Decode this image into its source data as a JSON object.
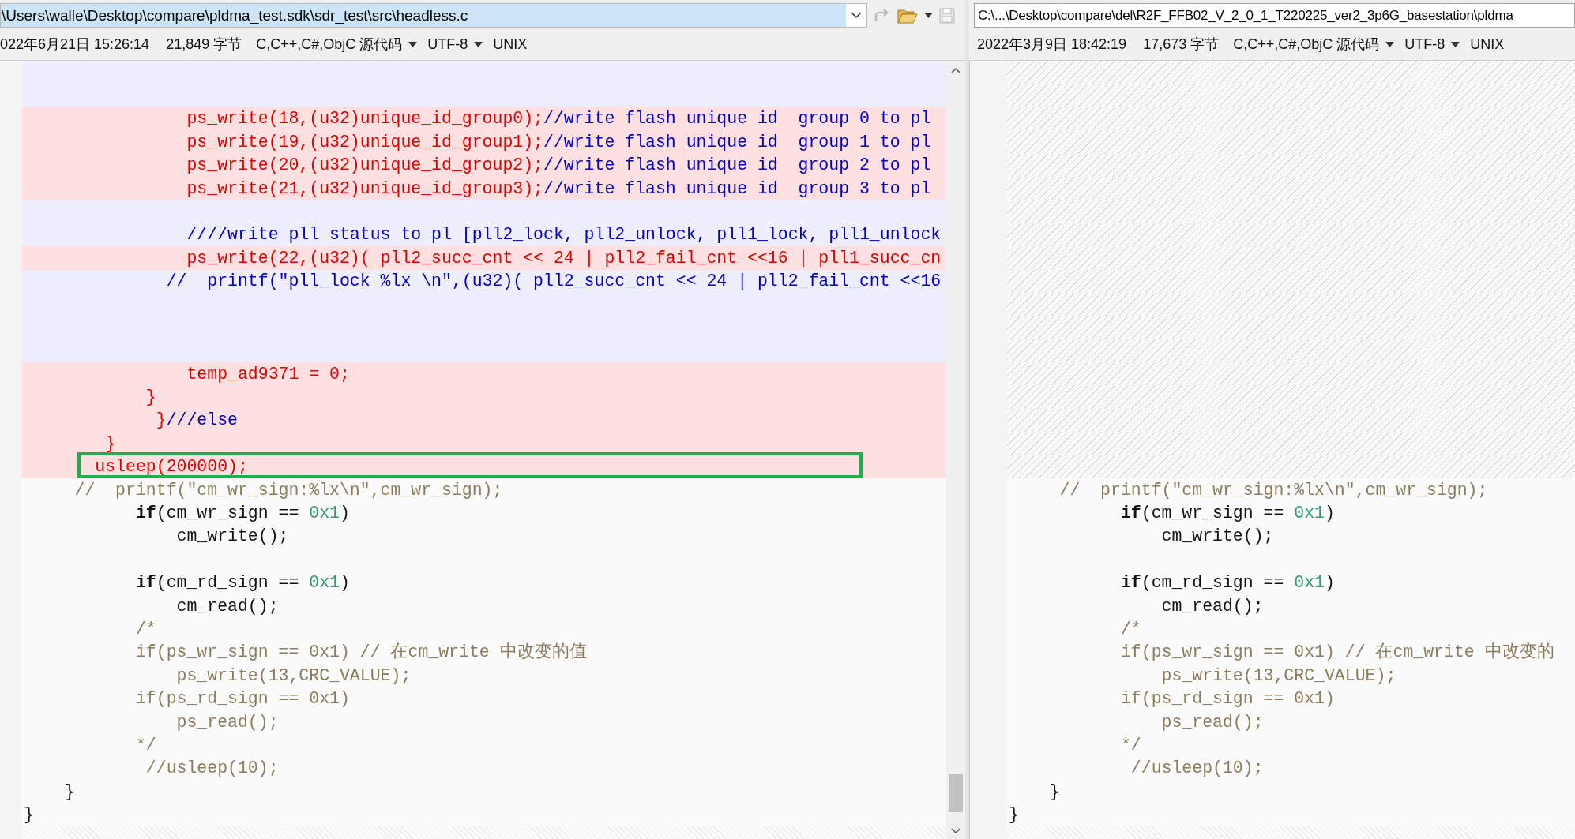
{
  "panes": [
    {
      "path": "\\Users\\walle\\Desktop\\compare\\pldma_test.sdk\\sdr_test\\src\\headless.c",
      "path_selected": true,
      "toolbar": true,
      "modified": "022年6月21日 15:26:14",
      "size": "21,849 字节",
      "format": "C,C++,C#,ObjC 源代码",
      "encoding": "UTF-8",
      "line_ending": "UNIX",
      "scrollbar": true,
      "lines": [
        {
          "kind": "changed"
        },
        {
          "kind": "changed"
        },
        {
          "kind": "removed",
          "segments": [
            {
              "text": "                ps_write(18,(u32)unique_id_group0);",
              "kind": "deleted"
            },
            {
              "text": "//write flash unique id  group 0 to pl",
              "kind": "deleted-comment"
            }
          ]
        },
        {
          "kind": "removed",
          "segments": [
            {
              "text": "                ps_write(19,(u32)unique_id_group1);",
              "kind": "deleted"
            },
            {
              "text": "//write flash unique id  group 1 to pl",
              "kind": "deleted-comment"
            }
          ]
        },
        {
          "kind": "removed",
          "segments": [
            {
              "text": "                ps_write(20,(u32)unique_id_group2);",
              "kind": "deleted"
            },
            {
              "text": "//write flash unique id  group 2 to pl",
              "kind": "deleted-comment"
            }
          ]
        },
        {
          "kind": "removed",
          "segments": [
            {
              "text": "                ps_write(21,(u32)unique_id_group3);",
              "kind": "deleted"
            },
            {
              "text": "//write flash unique id  group 3 to pl",
              "kind": "deleted-comment"
            }
          ]
        },
        {
          "kind": "changed"
        },
        {
          "kind": "changed",
          "segments": [
            {
              "text": "                ////write pll status to pl [pll2_lock, pll2_unlock, pll1_lock, pll1_unlock",
              "kind": "deleted-comment"
            }
          ]
        },
        {
          "kind": "removed",
          "segments": [
            {
              "text": "                ps_write(22,(u32)( pll2_succ_cnt << 24 | pll2_fail_cnt <<16 | pll1_succ_cn",
              "kind": "deleted"
            }
          ]
        },
        {
          "kind": "changed",
          "segments": [
            {
              "text": "              //  printf(\"pll_lock %lx \\n\",(u32)( pll2_succ_cnt << 24 | pll2_fail_cnt <<16",
              "kind": "deleted-comment"
            }
          ]
        },
        {
          "kind": "changed"
        },
        {
          "kind": "changed"
        },
        {
          "kind": "changed"
        },
        {
          "kind": "removed",
          "segments": [
            {
              "text": "                temp_ad9371 = 0;",
              "kind": "deleted"
            }
          ]
        },
        {
          "kind": "removed",
          "segments": [
            {
              "text": "            }",
              "kind": "deleted"
            }
          ]
        },
        {
          "kind": "removed",
          "segments": [
            {
              "text": "             }",
              "kind": "deleted"
            },
            {
              "text": "///else",
              "kind": "deleted-comment"
            }
          ]
        },
        {
          "kind": "removed",
          "segments": [
            {
              "text": "        }",
              "kind": "deleted"
            }
          ]
        },
        {
          "kind": "removed",
          "highlighted": true,
          "segments": [
            {
              "text": "       usleep(200000);",
              "kind": "deleted"
            }
          ]
        },
        {
          "kind": "same",
          "segments": [
            {
              "text": "     //  printf(\"cm_wr_sign:%lx\\n\",cm_wr_sign);",
              "kind": "comment"
            }
          ]
        },
        {
          "kind": "same",
          "segments": [
            {
              "text": "           if",
              "kind": "keyword"
            },
            {
              "text": "(cm_wr_sign == ",
              "kind": "plain"
            },
            {
              "text": "0x1",
              "kind": "number"
            },
            {
              "text": ")",
              "kind": "plain"
            }
          ]
        },
        {
          "kind": "same",
          "segments": [
            {
              "text": "               cm_write();",
              "kind": "plain"
            }
          ]
        },
        {
          "kind": "same"
        },
        {
          "kind": "same",
          "segments": [
            {
              "text": "           if",
              "kind": "keyword"
            },
            {
              "text": "(cm_rd_sign == ",
              "kind": "plain"
            },
            {
              "text": "0x1",
              "kind": "number"
            },
            {
              "text": ")",
              "kind": "plain"
            }
          ]
        },
        {
          "kind": "same",
          "segments": [
            {
              "text": "               cm_read();",
              "kind": "plain"
            }
          ]
        },
        {
          "kind": "same",
          "segments": [
            {
              "text": "           /*",
              "kind": "comment"
            }
          ]
        },
        {
          "kind": "same",
          "segments": [
            {
              "text": "           if(ps_wr_sign == 0x1) // 在cm_write 中改变的值",
              "kind": "comment"
            }
          ]
        },
        {
          "kind": "same",
          "segments": [
            {
              "text": "               ps_write(13,CRC_VALUE);",
              "kind": "comment"
            }
          ]
        },
        {
          "kind": "same",
          "segments": [
            {
              "text": "           if(ps_rd_sign == 0x1)",
              "kind": "comment"
            }
          ]
        },
        {
          "kind": "same",
          "segments": [
            {
              "text": "               ps_read();",
              "kind": "comment"
            }
          ]
        },
        {
          "kind": "same",
          "segments": [
            {
              "text": "           */",
              "kind": "comment"
            }
          ]
        },
        {
          "kind": "same",
          "segments": [
            {
              "text": "            //usleep(10);",
              "kind": "comment"
            }
          ]
        },
        {
          "kind": "same",
          "segments": [
            {
              "text": "    }",
              "kind": "plain"
            }
          ]
        },
        {
          "kind": "same",
          "segments": [
            {
              "text": "}",
              "kind": "plain"
            }
          ]
        }
      ]
    },
    {
      "path": "C:\\...\\Desktop\\compare\\del\\R2F_FFB02_V_2_0_1_T220225_ver2_3p6G_basestation\\pldma",
      "path_selected": false,
      "toolbar": false,
      "modified": "2022年3月9日 18:42:19",
      "size": "17,673 字节",
      "format": "C,C++,C#,ObjC 源代码",
      "encoding": "UTF-8",
      "line_ending": "UNIX",
      "scrollbar": false,
      "lines": [
        {
          "kind": "missing"
        },
        {
          "kind": "missing"
        },
        {
          "kind": "missing"
        },
        {
          "kind": "missing"
        },
        {
          "kind": "missing"
        },
        {
          "kind": "missing"
        },
        {
          "kind": "missing"
        },
        {
          "kind": "missing"
        },
        {
          "kind": "missing"
        },
        {
          "kind": "missing"
        },
        {
          "kind": "missing"
        },
        {
          "kind": "missing"
        },
        {
          "kind": "missing"
        },
        {
          "kind": "missing"
        },
        {
          "kind": "missing"
        },
        {
          "kind": "missing"
        },
        {
          "kind": "missing"
        },
        {
          "kind": "missing"
        },
        {
          "kind": "same",
          "segments": [
            {
              "text": "     //  printf(\"cm_wr_sign:%lx\\n\",cm_wr_sign);",
              "kind": "comment"
            }
          ]
        },
        {
          "kind": "same",
          "segments": [
            {
              "text": "           if",
              "kind": "keyword"
            },
            {
              "text": "(cm_wr_sign == ",
              "kind": "plain"
            },
            {
              "text": "0x1",
              "kind": "number"
            },
            {
              "text": ")",
              "kind": "plain"
            }
          ]
        },
        {
          "kind": "same",
          "segments": [
            {
              "text": "               cm_write();",
              "kind": "plain"
            }
          ]
        },
        {
          "kind": "same"
        },
        {
          "kind": "same",
          "segments": [
            {
              "text": "           if",
              "kind": "keyword"
            },
            {
              "text": "(cm_rd_sign == ",
              "kind": "plain"
            },
            {
              "text": "0x1",
              "kind": "number"
            },
            {
              "text": ")",
              "kind": "plain"
            }
          ]
        },
        {
          "kind": "same",
          "segments": [
            {
              "text": "               cm_read();",
              "kind": "plain"
            }
          ]
        },
        {
          "kind": "same",
          "segments": [
            {
              "text": "           /*",
              "kind": "comment"
            }
          ]
        },
        {
          "kind": "same",
          "segments": [
            {
              "text": "           if(ps_wr_sign == 0x1) // 在cm_write 中改变的",
              "kind": "comment"
            }
          ]
        },
        {
          "kind": "same",
          "segments": [
            {
              "text": "               ps_write(13,CRC_VALUE);",
              "kind": "comment"
            }
          ]
        },
        {
          "kind": "same",
          "segments": [
            {
              "text": "           if(ps_rd_sign == 0x1)",
              "kind": "comment"
            }
          ]
        },
        {
          "kind": "same",
          "segments": [
            {
              "text": "               ps_read();",
              "kind": "comment"
            }
          ]
        },
        {
          "kind": "same",
          "segments": [
            {
              "text": "           */",
              "kind": "comment"
            }
          ]
        },
        {
          "kind": "same",
          "segments": [
            {
              "text": "            //usleep(10);",
              "kind": "comment"
            }
          ]
        },
        {
          "kind": "same",
          "segments": [
            {
              "text": "    }",
              "kind": "plain"
            }
          ]
        },
        {
          "kind": "same",
          "segments": [
            {
              "text": "}",
              "kind": "plain"
            }
          ]
        }
      ]
    }
  ]
}
